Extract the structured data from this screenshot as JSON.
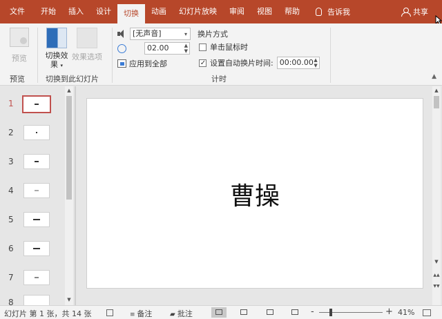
{
  "tabs": [
    "文件",
    "开始",
    "插入",
    "设计",
    "切换",
    "动画",
    "幻灯片放映",
    "审阅",
    "视图",
    "帮助"
  ],
  "active_tab": "切换",
  "tell_me": "告诉我",
  "share": "共享",
  "ribbon": {
    "preview_label": "预览",
    "preview_group": "预览",
    "transition_btn": "切换效果",
    "transition_btn_line1": "切换效",
    "transition_btn_line2": "果",
    "effect_options_btn": "效果选项",
    "transition_group": "切换到此幻灯片",
    "sound_value": "[无声音]",
    "duration_value": "02.00",
    "apply_all": "应用到全部",
    "advance_title": "换片方式",
    "on_click": "单击鼠标时",
    "on_click_checked": false,
    "after_time_label": "设置自动换片时间:",
    "after_time_checked": true,
    "after_time_value": "00:00.00",
    "timing_group": "计时"
  },
  "thumbnails": [
    {
      "num": "1",
      "selected": true
    },
    {
      "num": "2",
      "selected": false
    },
    {
      "num": "3",
      "selected": false
    },
    {
      "num": "4",
      "selected": false
    },
    {
      "num": "5",
      "selected": false
    },
    {
      "num": "6",
      "selected": false
    },
    {
      "num": "7",
      "selected": false
    },
    {
      "num": "8",
      "selected": false
    }
  ],
  "slide": {
    "title": "曹操"
  },
  "status": {
    "slide_info": "幻灯片 第 1 张，共 14 张",
    "notes": "备注",
    "comments": "批注",
    "zoom": "41%",
    "zoom_minus": "-",
    "zoom_plus": "+"
  },
  "colors": {
    "accent": "#b7472a",
    "selection": "#c0504d"
  }
}
